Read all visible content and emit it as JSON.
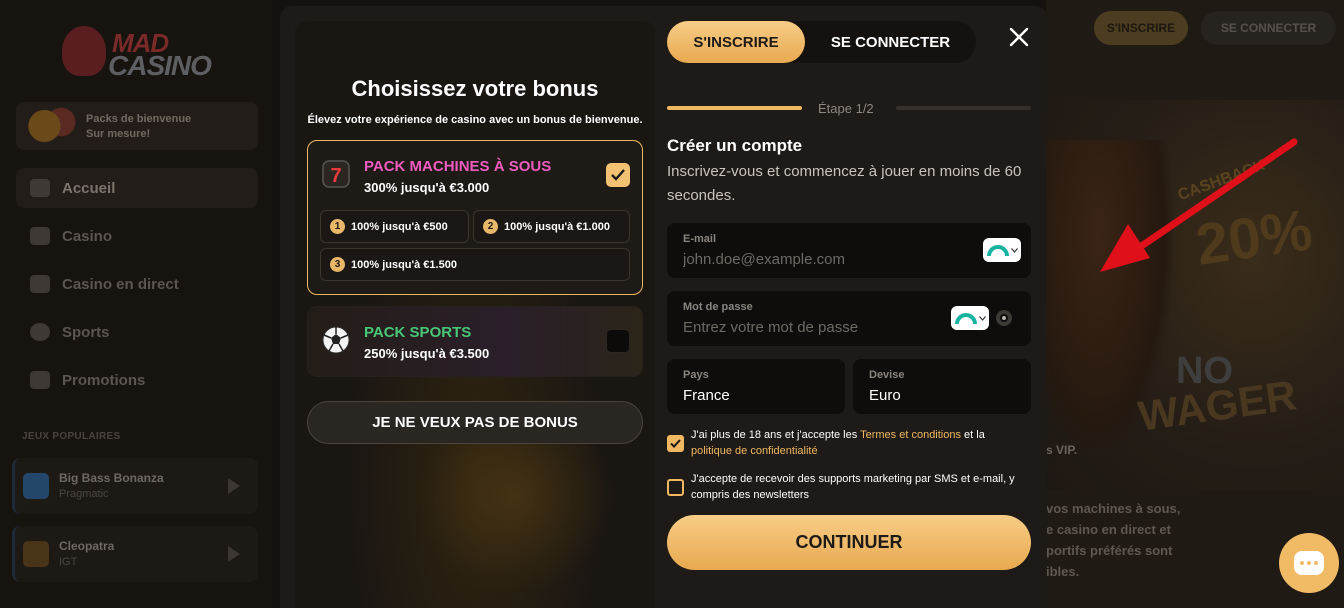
{
  "background": {
    "logo": {
      "top": "MAD",
      "bottom": "CASINO"
    },
    "promo_card": {
      "line1": "Packs de bienvenue",
      "line2": "Sur mesure!"
    },
    "nav": [
      {
        "label": "Accueil",
        "icon": "home-icon",
        "active": true
      },
      {
        "label": "Casino",
        "icon": "slot-machine-icon",
        "active": false
      },
      {
        "label": "Casino en direct",
        "icon": "cards-icon",
        "active": false
      },
      {
        "label": "Sports",
        "icon": "ball-icon",
        "active": false
      },
      {
        "label": "Promotions",
        "icon": "gift-icon",
        "active": false
      }
    ],
    "popular_title": "JEUX POPULAIRES",
    "games": [
      {
        "name": "Big Bass Bonanza",
        "provider": "Pragmatic"
      },
      {
        "name": "Cleopatra",
        "provider": "IGT"
      }
    ],
    "header": {
      "signup": "S'INSCRIRE",
      "login": "SE CONNECTER"
    },
    "hero": {
      "cashback": "CASHBACK",
      "pct": "20%",
      "no": "NO",
      "wager": "WAGER"
    },
    "vip_text": "s VIP.",
    "desc_lines": [
      "vos machines à sous,",
      "e casino en direct et",
      "portifs préférés sont",
      "ibles."
    ]
  },
  "modal": {
    "bonus": {
      "title": "Choisissez votre bonus",
      "subtitle": "Élevez votre expérience de casino avec un bonus de bienvenue.",
      "packs": [
        {
          "name": "PACK MACHINES À SOUS",
          "desc": "300% jusqu'à €3.000",
          "icon": "slot-777-icon",
          "selected": true,
          "tiers": [
            {
              "num": "1",
              "label": "100% jusqu'à €500"
            },
            {
              "num": "2",
              "label": "100% jusqu'à €1.000"
            },
            {
              "num": "3",
              "label": "100% jusqu'à €1.500"
            }
          ]
        },
        {
          "name": "PACK SPORTS",
          "desc": "250% jusqu'à €3.500",
          "icon": "soccer-ball-icon",
          "selected": false
        }
      ],
      "no_bonus": "JE NE VEUX PAS DE BONUS"
    },
    "tabs": {
      "signup": "S'INSCRIRE",
      "login": "SE CONNECTER"
    },
    "step_label": "Étape 1/2",
    "form": {
      "title": "Créer un compte",
      "subtitle": "Inscrivez-vous et commencez à jouer en moins de 60 secondes.",
      "email": {
        "label": "E-mail",
        "placeholder": "john.doe@example.com",
        "value": ""
      },
      "password": {
        "label": "Mot de passe",
        "placeholder": "Entrez votre mot de passe",
        "value": ""
      },
      "country": {
        "label": "Pays",
        "value": "France"
      },
      "currency": {
        "label": "Devise",
        "value": "Euro"
      },
      "terms": {
        "checked": true,
        "prefix": "J'ai plus de 18 ans et j'accepte les ",
        "link1": "Termes et conditions",
        "mid": " et la ",
        "link2": "politique de confidentialité"
      },
      "marketing": {
        "checked": false,
        "text": "J'accepte de recevoir des supports marketing par SMS et e-mail, y compris des newsletters"
      },
      "continue": "CONTINUER"
    }
  },
  "colors": {
    "accent": "#f0b860",
    "slots": "#f05bbf",
    "sports": "#47c877",
    "arrow": "#e0101a"
  }
}
